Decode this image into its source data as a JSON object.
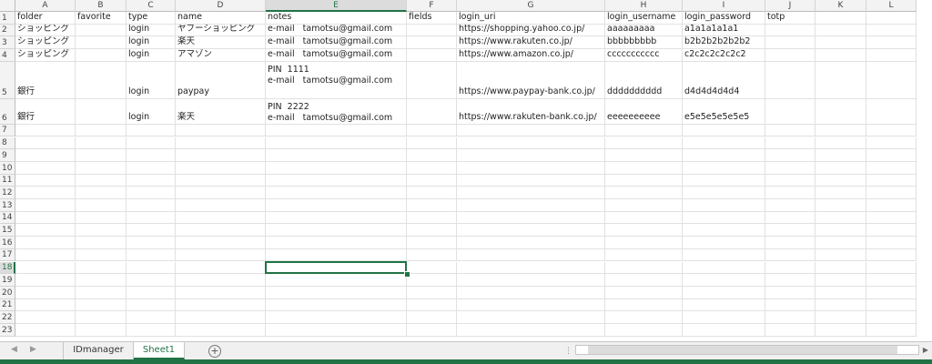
{
  "columns": [
    "A",
    "B",
    "C",
    "D",
    "E",
    "F",
    "G",
    "H",
    "I",
    "J",
    "K",
    "L"
  ],
  "selected_column": "E",
  "selected_row": 18,
  "row_numbers": [
    "1",
    "2",
    "3",
    "4",
    "5",
    "6",
    "7",
    "8",
    "9",
    "10",
    "11",
    "12",
    "13",
    "14",
    "15",
    "16",
    "17",
    "18",
    "19",
    "20",
    "21",
    "22",
    "23"
  ],
  "rows": [
    [
      "folder",
      "favorite",
      "type",
      "name",
      "notes",
      "fields",
      "login_uri",
      "login_username",
      "login_password",
      "totp",
      "",
      ""
    ],
    [
      "ショッピング",
      "",
      "login",
      "ヤフーショッピング",
      "e-mail   tamotsu@gmail.com",
      "",
      "https://shopping.yahoo.co.jp/",
      "aaaaaaaaa",
      "a1a1a1a1a1",
      "",
      "",
      ""
    ],
    [
      "ショッピング",
      "",
      "login",
      "楽天",
      "e-mail   tamotsu@gmail.com",
      "",
      "https://www.rakuten.co.jp/",
      "bbbbbbbbb",
      "b2b2b2b2b2b2",
      "",
      "",
      ""
    ],
    [
      "ショッピング",
      "",
      "login",
      "アマゾン",
      "e-mail   tamotsu@gmail.com",
      "",
      "https://www.amazon.co.jp/",
      "ccccccccccc",
      "c2c2c2c2c2c2",
      "",
      "",
      ""
    ],
    [
      "銀行",
      "",
      "login",
      "paypay",
      "PIN  1111\ne-mail   tamotsu@gmail.com",
      "",
      "https://www.paypay-bank.co.jp/",
      "dddddddddd",
      "d4d4d4d4d4",
      "",
      "",
      ""
    ],
    [
      "銀行",
      "",
      "login",
      "楽天",
      "PIN  2222\ne-mail   tamotsu@gmail.com",
      "",
      "https://www.rakuten-bank.co.jp/",
      "eeeeeeeeee",
      "e5e5e5e5e5e5",
      "",
      "",
      ""
    ]
  ],
  "tabs": [
    {
      "label": "IDmanager",
      "active": false
    },
    {
      "label": "Sheet1",
      "active": true
    }
  ],
  "add_sheet_label": "+",
  "nav_prev": "◀",
  "nav_next": "▶",
  "scroll_dots": "⋮",
  "scroll_left": "◀",
  "scroll_right": "▶",
  "accent_color": "#217346"
}
